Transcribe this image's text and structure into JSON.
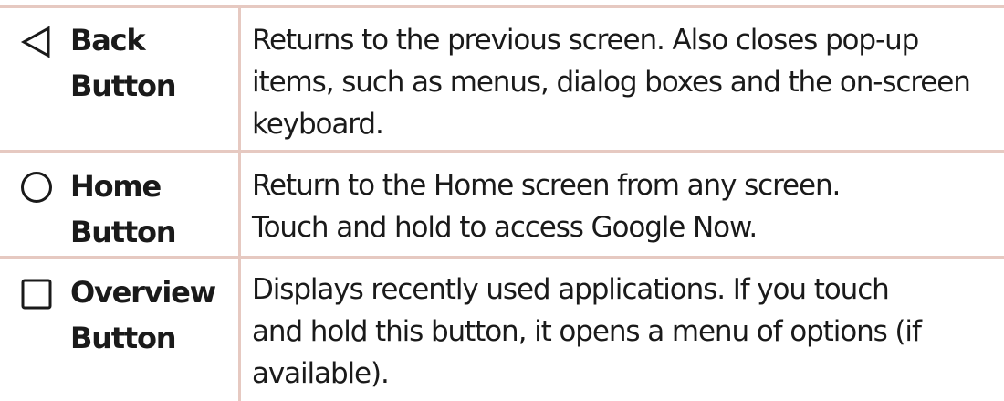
{
  "buttons": [
    {
      "icon": "back-triangle-icon",
      "label_line1": "Back",
      "label_line2": "Button",
      "desc_lines": [
        "Returns to the previous screen. Also closes pop-up",
        "items, such as menus, dialog boxes and the on-screen",
        "keyboard."
      ]
    },
    {
      "icon": "home-circle-icon",
      "label_line1": "Home",
      "label_line2": "Button",
      "desc_lines": [
        "Return to the Home screen from any screen.",
        "Touch and hold to access Google Now."
      ]
    },
    {
      "icon": "overview-square-icon",
      "label_line1": "Overview",
      "label_line2": "Button",
      "desc_lines": [
        "Displays recently used applications. If you touch",
        "and hold this button, it opens a menu of options (if",
        "available)."
      ]
    }
  ],
  "colors": {
    "rule": "#e6c9c1",
    "text": "#1a1a1a"
  }
}
